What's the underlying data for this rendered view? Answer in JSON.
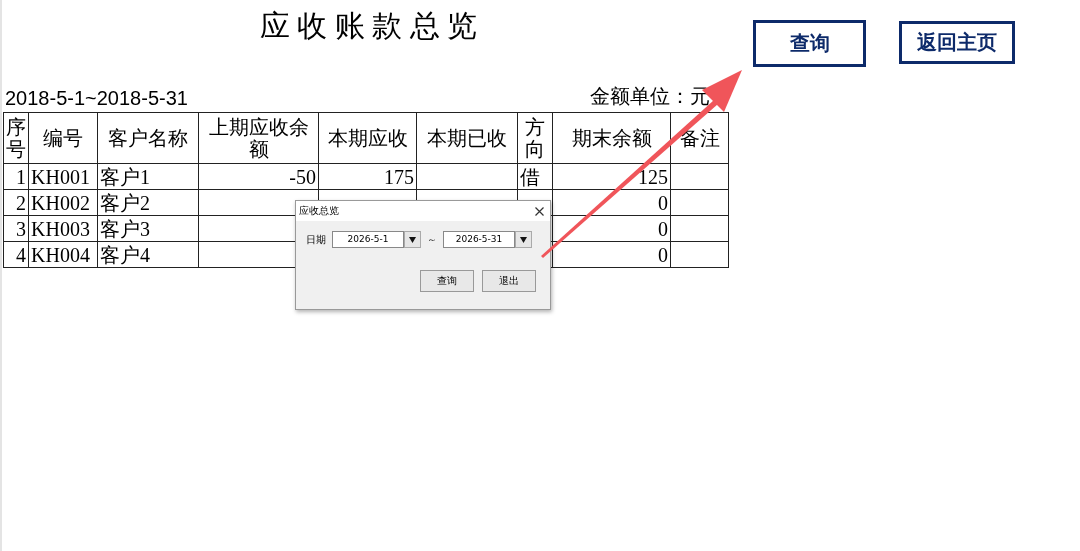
{
  "title": "应 收 账 款 总 览",
  "period": "2018-5-1~2018-5-31",
  "unit": "金额单位：元",
  "buttons": [
    "查询",
    "返回主页"
  ],
  "table": {
    "columns": [
      "序号",
      "编号",
      "客户名称",
      "上期应收余额",
      "本期应收",
      "本期已收",
      "方向",
      "期末余额",
      "备注"
    ],
    "rows": [
      {
        "no": "1",
        "code": "KH001",
        "name": "客户1",
        "prev": "-50",
        "debit": "175",
        "dir": "借",
        "end": "125"
      },
      {
        "no": "2",
        "code": "KH002",
        "name": "客户2",
        "end": "0"
      },
      {
        "no": "3",
        "code": "KH003",
        "name": "客户3",
        "end": "0"
      },
      {
        "no": "4",
        "code": "KH004",
        "name": "客户4",
        "end": "0"
      }
    ]
  },
  "dialog": {
    "title": "应收总览",
    "date_label": "日期",
    "from": "2026-5-1",
    "separator": "～",
    "to": "2026-5-31",
    "buttons": [
      "查询",
      "退出"
    ]
  }
}
